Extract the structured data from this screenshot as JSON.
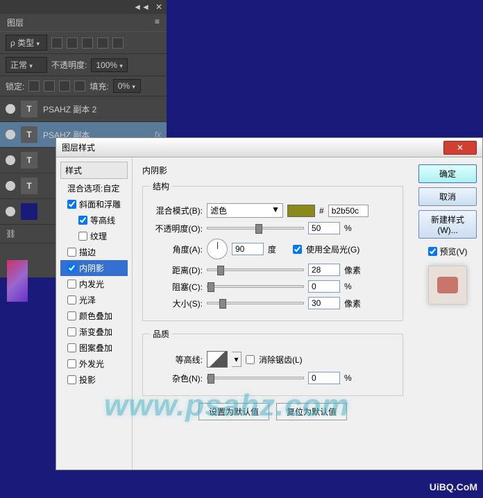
{
  "layers_panel": {
    "title": "图层",
    "kind_label": "类型",
    "blend": "正常",
    "opacity_label": "不透明度:",
    "opacity": "100%",
    "lock_label": "锁定:",
    "fill_label": "填充:",
    "fill": "0%",
    "layers": [
      {
        "name": "PSAHZ 副本 2",
        "type": "T"
      },
      {
        "name": "PSAHZ 副本",
        "type": "T",
        "fx": "fx"
      },
      {
        "name": "",
        "type": "T"
      },
      {
        "name": "",
        "type": "T"
      }
    ],
    "close_icons": {
      "arrows": "◄◄",
      "x": "✕",
      "menu": "≡"
    }
  },
  "dialog": {
    "title": "图层样式",
    "close": "✕",
    "styles_col": {
      "header": "样式",
      "blend_opts": "混合选项:自定",
      "items": [
        {
          "label": "斜面和浮雕",
          "checked": true
        },
        {
          "label": "等高线",
          "checked": true,
          "indent": true
        },
        {
          "label": "纹理",
          "checked": false,
          "indent": true
        },
        {
          "label": "描边",
          "checked": false
        },
        {
          "label": "内阴影",
          "checked": true,
          "selected": true
        },
        {
          "label": "内发光",
          "checked": false
        },
        {
          "label": "光泽",
          "checked": false
        },
        {
          "label": "颜色叠加",
          "checked": false
        },
        {
          "label": "渐变叠加",
          "checked": false
        },
        {
          "label": "图案叠加",
          "checked": false
        },
        {
          "label": "外发光",
          "checked": false
        },
        {
          "label": "投影",
          "checked": false
        }
      ]
    },
    "content": {
      "section_title": "内阴影",
      "structure_legend": "结构",
      "blend_mode_label": "混合模式(B):",
      "blend_mode_value": "滤色",
      "hash": "#",
      "color": "b2b50c",
      "opacity_label": "不透明度(O):",
      "opacity": "50",
      "percent": "%",
      "angle_label": "角度(A):",
      "angle": "90",
      "degree": "度",
      "global_light": "使用全局光(G)",
      "distance_label": "距离(D):",
      "distance": "28",
      "px": "像素",
      "choke_label": "阻塞(C):",
      "choke": "0",
      "size_label": "大小(S):",
      "size": "30",
      "quality_legend": "品质",
      "contour_label": "等高线:",
      "antialias": "消除锯齿(L)",
      "noise_label": "杂色(N):",
      "noise": "0",
      "btn_default": "设置为默认值",
      "btn_reset": "复位为默认值"
    },
    "side": {
      "ok": "确定",
      "cancel": "取消",
      "new_style": "新建样式(W)...",
      "preview": "预览(V)"
    }
  },
  "watermark": "www.psahz.com",
  "watermark2": "UiBQ.CoM"
}
